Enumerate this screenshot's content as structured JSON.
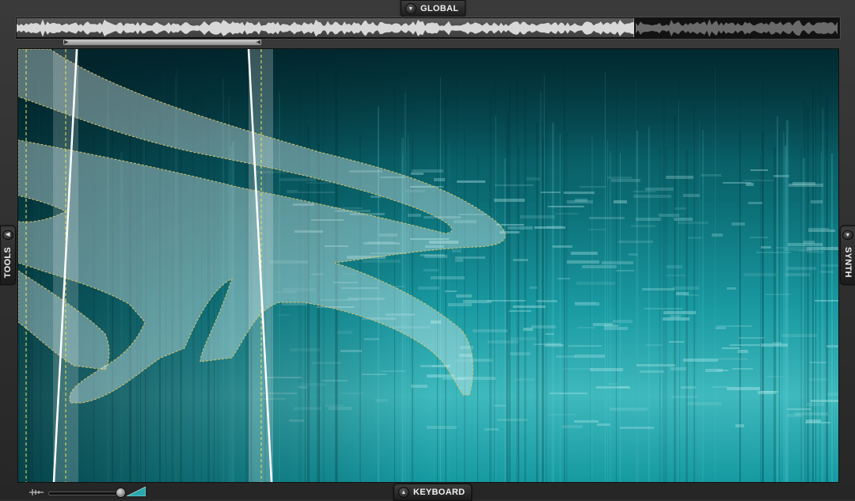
{
  "panels": {
    "global_label": "GLOBAL",
    "keyboard_label": "KEYBOARD",
    "tools_label": "TOOLS",
    "synth_label": "SYNTH"
  },
  "icons": {
    "global_toggle": "triangle-down-icon",
    "keyboard_toggle": "triangle-up-icon",
    "tools_toggle": "triangle-left-icon",
    "synth_toggle": "triangle-down-icon",
    "zoom": "zoom-slider-icon"
  },
  "colors": {
    "spectrogram_accent": "#1fb3bb",
    "selection_outline": "#d9c36a",
    "marker_line": "#ffffff",
    "loop_line": "#e8e85a"
  },
  "overview": {
    "visible_fraction": 0.75
  }
}
